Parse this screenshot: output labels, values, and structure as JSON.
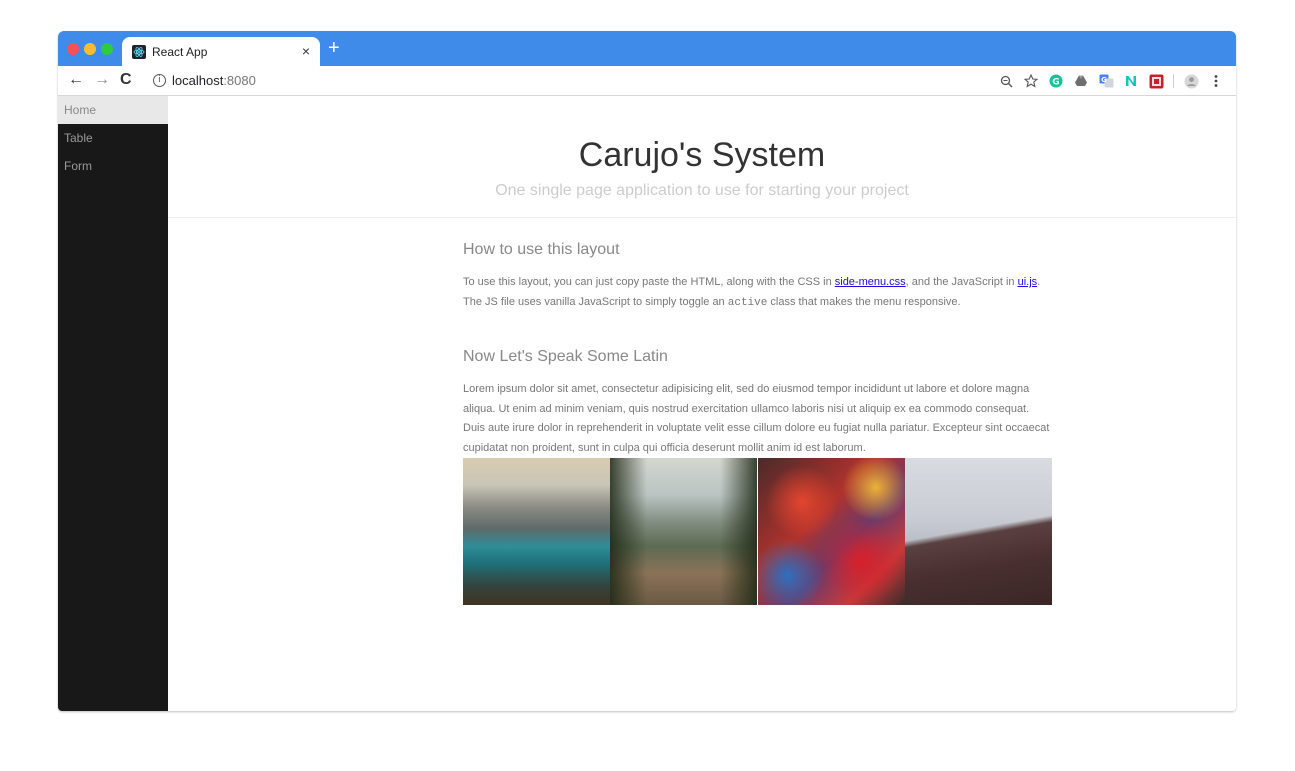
{
  "browser": {
    "tab_title": "React App",
    "tab_close": "×",
    "new_tab": "+",
    "url_host": "localhost",
    "url_port": ":8080",
    "nav": {
      "back": "←",
      "forward": "→",
      "reload": "C"
    },
    "info_icon": "i",
    "toolbar_icons": [
      "zoom-icon",
      "star-icon",
      "grammarly-icon",
      "drive-icon",
      "translate-icon",
      "extension-n-icon",
      "extension-red-icon",
      "profile-icon",
      "menu-icon"
    ]
  },
  "sidemenu": {
    "items": [
      {
        "label": "Home",
        "active": true
      },
      {
        "label": "Table",
        "active": false
      },
      {
        "label": "Form",
        "active": false
      }
    ]
  },
  "header": {
    "title": "Carujo's System",
    "subtitle": "One single page application to use for starting your project"
  },
  "content": {
    "section1": {
      "heading": "How to use this layout",
      "text_before_link1": "To use this layout, you can just copy paste the HTML, along with the CSS in ",
      "link1": "side-menu.css",
      "text_before_link2": ", and the JavaScript in ",
      "link2": "ui.js",
      "text_before_code": ". The JS file uses vanilla JavaScript to simply toggle an ",
      "code": "active",
      "text_after_code": " class that makes the menu responsive."
    },
    "section2": {
      "heading": "Now Let's Speak Some Latin",
      "paragraph": "Lorem ipsum dolor sit amet, consectetur adipisicing elit, sed do eiusmod tempor incididunt ut labore et dolore magna aliqua. Ut enim ad minim veniam, quis nostrud exercitation ullamco laboris nisi ut aliquip ex ea commodo consequat. Duis aute irure dolor in reprehenderit in voluptate velit esse cillum dolore eu fugiat nulla pariatur. Excepteur sint occaecat cupidatat non proident, sunt in culpa qui officia deserunt mollit anim id est laborum."
    },
    "photos": [
      "lake-photo",
      "forest-photo",
      "market-photo",
      "hill-photo"
    ]
  }
}
